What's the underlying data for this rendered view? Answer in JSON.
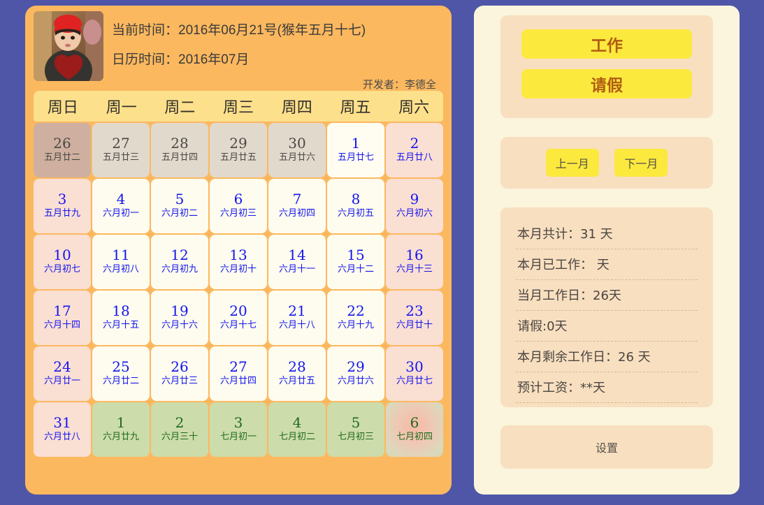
{
  "header": {
    "current_time_label": "当前时间：2016年06月21号(猴年五月十七)",
    "calendar_time_label": "日历时间：2016年07月",
    "developer_label": "开发者：李德全",
    "avatar_name": "child-photo"
  },
  "weekdays": [
    "周日",
    "周一",
    "周二",
    "周三",
    "周四",
    "周五",
    "周六"
  ],
  "days": [
    {
      "num": "26",
      "lunar": "五月廿二",
      "type": "prev-sun"
    },
    {
      "num": "27",
      "lunar": "五月廿三",
      "type": "prev"
    },
    {
      "num": "28",
      "lunar": "五月廿四",
      "type": "prev"
    },
    {
      "num": "29",
      "lunar": "五月廿五",
      "type": "prev"
    },
    {
      "num": "30",
      "lunar": "五月廿六",
      "type": "prev"
    },
    {
      "num": "1",
      "lunar": "五月廿七",
      "type": "today"
    },
    {
      "num": "2",
      "lunar": "五月廿八",
      "type": "weekend"
    },
    {
      "num": "3",
      "lunar": "五月廿九",
      "type": "weekend"
    },
    {
      "num": "4",
      "lunar": "六月初一",
      "type": "weekday"
    },
    {
      "num": "5",
      "lunar": "六月初二",
      "type": "weekday"
    },
    {
      "num": "6",
      "lunar": "六月初三",
      "type": "weekday"
    },
    {
      "num": "7",
      "lunar": "六月初四",
      "type": "weekday"
    },
    {
      "num": "8",
      "lunar": "六月初五",
      "type": "weekday"
    },
    {
      "num": "9",
      "lunar": "六月初六",
      "type": "weekend"
    },
    {
      "num": "10",
      "lunar": "六月初七",
      "type": "weekend"
    },
    {
      "num": "11",
      "lunar": "六月初八",
      "type": "weekday"
    },
    {
      "num": "12",
      "lunar": "六月初九",
      "type": "weekday"
    },
    {
      "num": "13",
      "lunar": "六月初十",
      "type": "weekday"
    },
    {
      "num": "14",
      "lunar": "六月十一",
      "type": "weekday"
    },
    {
      "num": "15",
      "lunar": "六月十二",
      "type": "weekday"
    },
    {
      "num": "16",
      "lunar": "六月十三",
      "type": "weekend"
    },
    {
      "num": "17",
      "lunar": "六月十四",
      "type": "weekend"
    },
    {
      "num": "18",
      "lunar": "六月十五",
      "type": "weekday"
    },
    {
      "num": "19",
      "lunar": "六月十六",
      "type": "weekday"
    },
    {
      "num": "20",
      "lunar": "六月十七",
      "type": "weekday"
    },
    {
      "num": "21",
      "lunar": "六月十八",
      "type": "weekday"
    },
    {
      "num": "22",
      "lunar": "六月十九",
      "type": "weekday"
    },
    {
      "num": "23",
      "lunar": "六月廿十",
      "type": "weekend"
    },
    {
      "num": "24",
      "lunar": "六月廿一",
      "type": "weekend"
    },
    {
      "num": "25",
      "lunar": "六月廿二",
      "type": "weekday"
    },
    {
      "num": "26",
      "lunar": "六月廿三",
      "type": "weekday"
    },
    {
      "num": "27",
      "lunar": "六月廿四",
      "type": "weekday"
    },
    {
      "num": "28",
      "lunar": "六月廿五",
      "type": "weekday"
    },
    {
      "num": "29",
      "lunar": "六月廿六",
      "type": "weekday"
    },
    {
      "num": "30",
      "lunar": "六月廿七",
      "type": "weekend"
    },
    {
      "num": "31",
      "lunar": "六月廿八",
      "type": "weekend"
    },
    {
      "num": "1",
      "lunar": "六月廿九",
      "type": "next"
    },
    {
      "num": "2",
      "lunar": "六月三十",
      "type": "next"
    },
    {
      "num": "3",
      "lunar": "七月初一",
      "type": "next"
    },
    {
      "num": "4",
      "lunar": "七月初二",
      "type": "next"
    },
    {
      "num": "5",
      "lunar": "七月初三",
      "type": "next"
    },
    {
      "num": "6",
      "lunar": "七月初四",
      "type": "selected"
    }
  ],
  "sidebar": {
    "work_label": "工作",
    "leave_label": "请假",
    "prev_month_label": "上一月",
    "next_month_label": "下一月",
    "stats": [
      "本月共计：31 天",
      "本月已工作： 天",
      "当月工作日：26天",
      "请假:0天",
      "本月剩余工作日：26 天",
      "预计工资：**天"
    ],
    "settings_label": "设置"
  },
  "colors": {
    "page_background": "#4f56a8",
    "calendar_panel": "#fcb85f",
    "sidebar_panel": "#faf5dc",
    "card": "#f8dfc0",
    "weekday_header": "#fce08c",
    "action_button": "#fce93e",
    "action_button_text": "#b05c12",
    "day_text_blue": "#1414f0",
    "next_month_green": "#1d6b1d",
    "weekend_cell": "#fadfd3",
    "weekday_cell": "#fdfcee",
    "next_month_cell": "#cddcab",
    "prev_month_cell": "#e2d9cd",
    "prev_sunday_cell": "#cfb0a0"
  }
}
